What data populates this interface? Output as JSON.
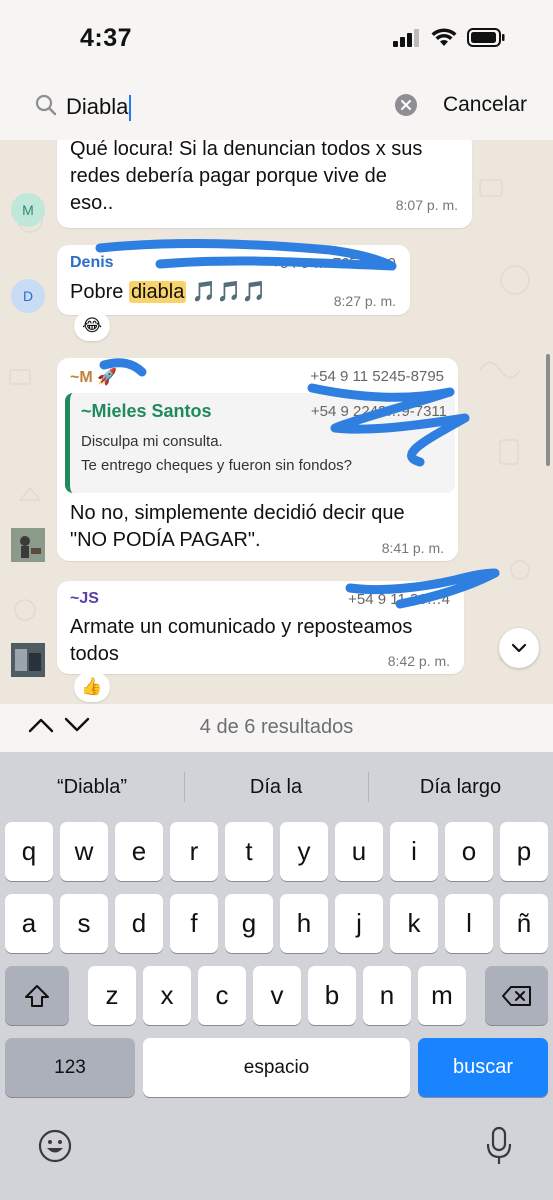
{
  "status_bar": {
    "time": "4:37"
  },
  "search": {
    "query": "Diabla",
    "cancel_label": "Cancelar"
  },
  "messages": [
    {
      "lines": [
        "Qué locura! Si la denuncian todos x sus",
        "redes debería pagar porque vive de",
        "eso.."
      ],
      "time": "8:07 p. m.",
      "avatar_letter": "M"
    },
    {
      "sender": "Denis",
      "phone": "+54 9 … 765-8629",
      "text_before": "Pobre ",
      "highlight": "diabla",
      "text_after": " 🎵🎵🎵",
      "time": "8:27 p. m.",
      "avatar_letter": "D",
      "reaction": "😂"
    },
    {
      "sender": "~M",
      "sender_emoji": "🚀",
      "phone": "+54 9 11 5245-8795",
      "quote": {
        "sender": "~Mieles Santos",
        "phone": "+54 9 2243…9-7311",
        "lines": [
          "Disculpa mi consulta.",
          "Te entrego cheques y fueron sin fondos?"
        ]
      },
      "lines": [
        "No no, simplemente decidió decir que",
        "\"NO PODÍA PAGAR\"."
      ],
      "time": "8:41 p. m."
    },
    {
      "sender": "~JS",
      "phone": "+54 9 11 36…4",
      "lines": [
        "Armate un comunicado y reposteamos",
        "todos"
      ],
      "time": "8:42 p. m.",
      "reaction": "👍"
    }
  ],
  "results": {
    "count_text": "4 de 6 resultados"
  },
  "keyboard": {
    "suggestions": [
      "“Diabla”",
      "Día la",
      "Día largo"
    ],
    "row1": [
      "q",
      "w",
      "e",
      "r",
      "t",
      "y",
      "u",
      "i",
      "o",
      "p"
    ],
    "row2": [
      "a",
      "s",
      "d",
      "f",
      "g",
      "h",
      "j",
      "k",
      "l",
      "ñ"
    ],
    "row3": [
      "z",
      "x",
      "c",
      "v",
      "b",
      "n",
      "m"
    ],
    "numbers_label": "123",
    "space_label": "espacio",
    "action_label": "buscar"
  },
  "colors": {
    "accent": "#1a84ff",
    "highlight": "#f8d26a",
    "quote_bar": "#1f8a5b",
    "sender_denis": "#2a6fc9",
    "sender_js": "#5b3ea8",
    "sender_m": "#c2813b"
  }
}
